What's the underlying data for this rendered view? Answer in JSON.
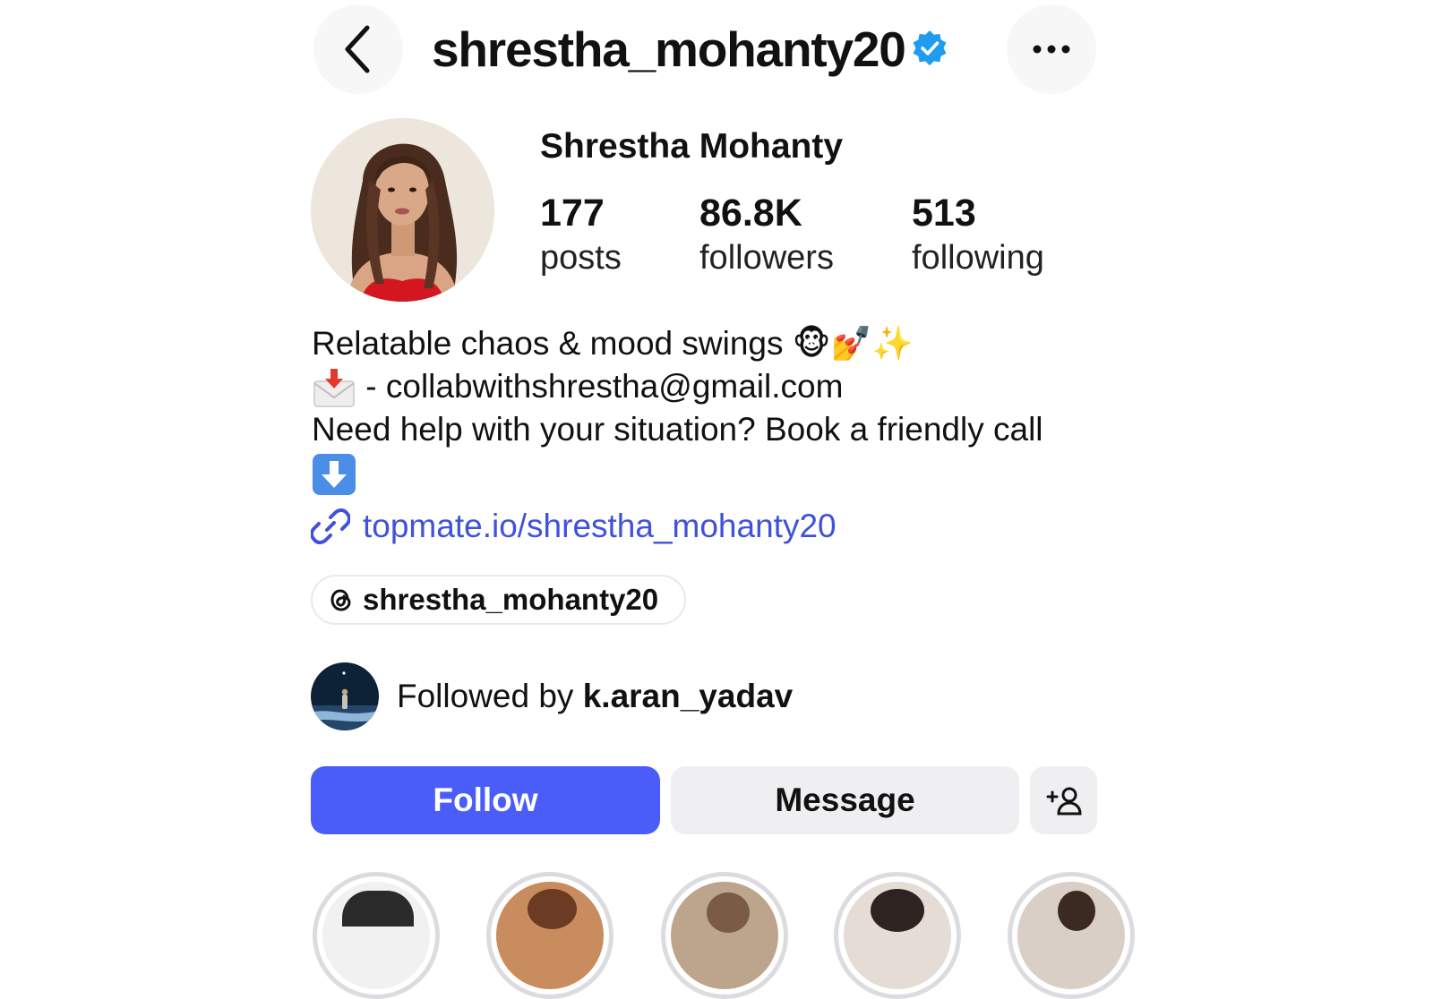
{
  "header": {
    "username": "shrestha_mohanty20",
    "verified": true,
    "icons": {
      "back": "chevron-left-icon",
      "more": "more-horizontal-icon",
      "verified": "verified-badge-icon"
    }
  },
  "profile": {
    "display_name": "Shrestha Mohanty",
    "stats": {
      "posts_count": "177",
      "posts_label": "posts",
      "followers_count": "86.8K",
      "followers_label": "followers",
      "following_count": "513",
      "following_label": "following"
    }
  },
  "bio": {
    "line1": "Relatable chaos & mood swings 🐵💅✨",
    "line2_text": " - collabwithshrestha@gmail.com",
    "line3": "Need help with your situation? Book a friendly call",
    "line4_icon": "down-arrow-emoji-icon",
    "link": "topmate.io/shrestha_mohanty20"
  },
  "threads": {
    "username": "shrestha_mohanty20",
    "icon": "threads-icon"
  },
  "followed_by": {
    "prefix": "Followed by ",
    "username": "k.aran_yadav"
  },
  "actions": {
    "follow_label": "Follow",
    "message_label": "Message",
    "add_icon": "add-person-icon"
  },
  "colors": {
    "accent": "#4a5df9",
    "link": "#3f52d9",
    "verified": "#1f9bf0",
    "secondary_button": "#efeff2"
  }
}
